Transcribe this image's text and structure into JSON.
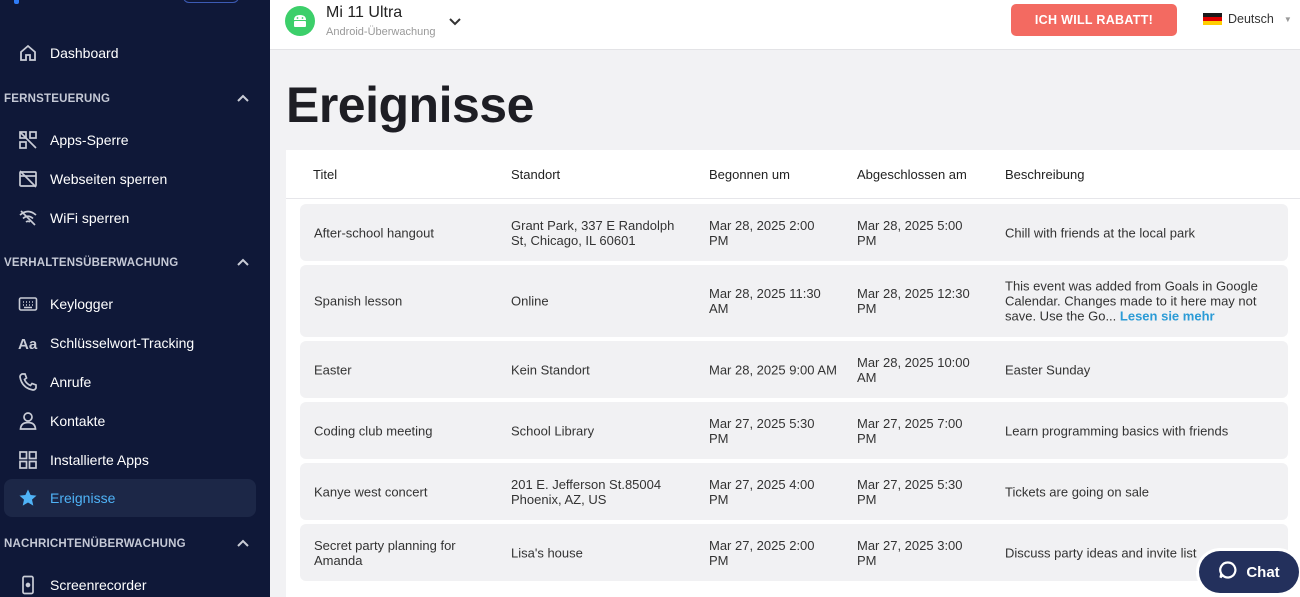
{
  "sidebar": {
    "items": [
      {
        "key": "dashboard",
        "label": "Dashboard",
        "icon": "home-icon"
      },
      {
        "key": "apps-sperre",
        "label": "Apps-Sperre",
        "icon": "apps-block-icon"
      },
      {
        "key": "webseiten",
        "label": "Webseiten sperren",
        "icon": "web-block-icon"
      },
      {
        "key": "wifi",
        "label": "WiFi sperren",
        "icon": "wifi-off-icon"
      },
      {
        "key": "keylogger",
        "label": "Keylogger",
        "icon": "keyboard-icon"
      },
      {
        "key": "keyword",
        "label": "Schlüsselwort-Tracking",
        "icon": "text-aa-icon"
      },
      {
        "key": "anrufe",
        "label": "Anrufe",
        "icon": "phone-icon"
      },
      {
        "key": "kontakte",
        "label": "Kontakte",
        "icon": "person-icon"
      },
      {
        "key": "installierte",
        "label": "Installierte Apps",
        "icon": "apps-grid-icon"
      },
      {
        "key": "ereignisse",
        "label": "Ereignisse",
        "icon": "star-icon",
        "active": true
      },
      {
        "key": "screenrecorder",
        "label": "Screenrecorder",
        "icon": "screen-record-icon"
      }
    ],
    "sections": {
      "fernsteuerung": "FERNSTEUERUNG",
      "verhalten": "VERHALTENSÜBERWACHUNG",
      "nachrichten": "NACHRICHTENÜBERWACHUNG"
    }
  },
  "header": {
    "device_name": "Mi 11 Ultra",
    "device_sub": "Android-Überwachung",
    "promo": "ICH WILL RABATT!",
    "language": "Deutsch"
  },
  "page": {
    "title": "Ereignisse"
  },
  "table": {
    "columns": [
      "Titel",
      "Standort",
      "Begonnen um",
      "Abgeschlossen am",
      "Beschreibung"
    ],
    "rows": [
      {
        "title": "After-school hangout",
        "location": "Grant Park, 337 E Randolph St, Chicago, IL 60601",
        "start": "Mar 28, 2025 2:00 PM",
        "end": "Mar 28, 2025 5:00 PM",
        "desc": "Chill with friends at the local park",
        "more": ""
      },
      {
        "title": "Spanish lesson",
        "location": "Online",
        "start": "Mar 28, 2025 11:30 AM",
        "end": "Mar 28, 2025 12:30 PM",
        "desc": "This event was added from Goals in Google Calendar. Changes made to it here may not save. Use the Go...",
        "more": "Lesen sie mehr"
      },
      {
        "title": "Easter",
        "location": "Kein Standort",
        "start": "Mar 28, 2025 9:00 AM",
        "end": "Mar 28, 2025 10:00 AM",
        "desc": "Easter Sunday",
        "more": ""
      },
      {
        "title": "Coding club meeting",
        "location": "School Library",
        "start": "Mar 27, 2025 5:30 PM",
        "end": "Mar 27, 2025 7:00 PM",
        "desc": "Learn programming basics with friends",
        "more": ""
      },
      {
        "title": "Kanye west concert",
        "location": "201 E. Jefferson St.85004 Phoenix, AZ, US",
        "start": "Mar 27, 2025 4:00 PM",
        "end": "Mar 27, 2025 5:30 PM",
        "desc": "Tickets are going on sale",
        "more": ""
      },
      {
        "title": "Secret party planning for Amanda",
        "location": "Lisa's house",
        "start": "Mar 27, 2025 2:00 PM",
        "end": "Mar 27, 2025 3:00 PM",
        "desc": "Discuss party ideas and invite list",
        "more": ""
      }
    ]
  },
  "chat": {
    "label": "Chat"
  },
  "colors": {
    "sidebar_bg": "#0f1838",
    "accent": "#4fb3f7",
    "promo": "#f36a61",
    "android": "#3ccf6a",
    "chat": "#23305c"
  }
}
